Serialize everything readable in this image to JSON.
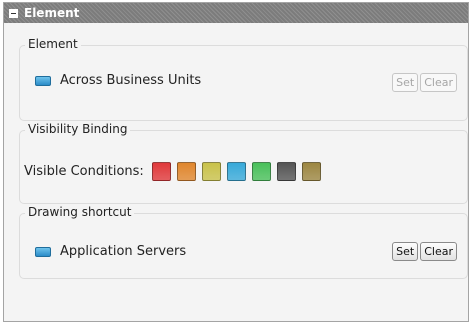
{
  "panel": {
    "title": "Element"
  },
  "element_section": {
    "legend": "Element",
    "value": "Across Business Units",
    "set_label": "Set",
    "clear_label": "Clear"
  },
  "visibility_section": {
    "legend": "Visibility Binding",
    "label": "Visible Conditions:",
    "swatches": [
      {
        "name": "red",
        "color": "#e0383a"
      },
      {
        "name": "orange",
        "color": "#e0862d"
      },
      {
        "name": "olive",
        "color": "#c9c24a"
      },
      {
        "name": "blue",
        "color": "#37a9d9"
      },
      {
        "name": "green",
        "color": "#49c05a"
      },
      {
        "name": "gray",
        "color": "#555555"
      },
      {
        "name": "brown",
        "color": "#9c8641"
      }
    ]
  },
  "drawing_section": {
    "legend": "Drawing shortcut",
    "value": "Application Servers",
    "set_label": "Set",
    "clear_label": "Clear"
  }
}
